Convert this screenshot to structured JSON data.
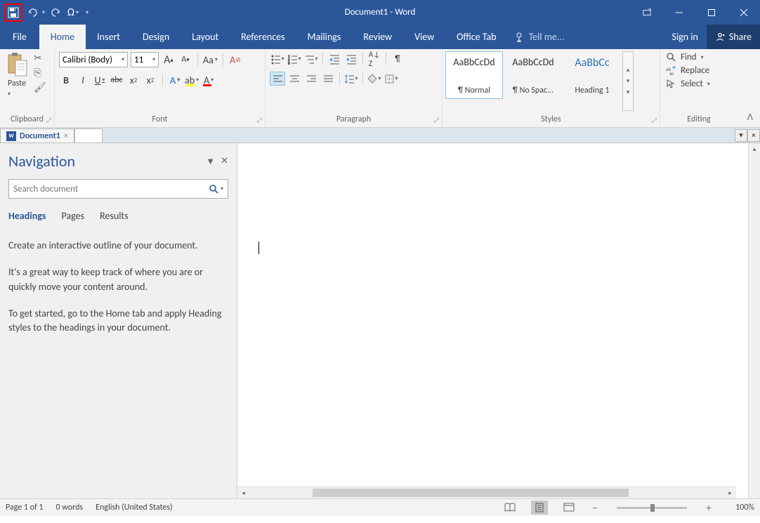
{
  "title": "Document1 - Word",
  "qat": {
    "omega": "Ω"
  },
  "tabs": {
    "file": "File",
    "home": "Home",
    "insert": "Insert",
    "design": "Design",
    "layout": "Layout",
    "references": "References",
    "mailings": "Mailings",
    "review": "Review",
    "view": "View",
    "office_tab": "Office Tab"
  },
  "tell_me": "Tell me...",
  "signin": "Sign in",
  "share": "Share",
  "ribbon": {
    "clipboard": {
      "paste": "Paste",
      "label": "Clipboard"
    },
    "font": {
      "name": "Calibri (Body)",
      "size": "11",
      "label": "Font",
      "grow": "A",
      "shrink": "A",
      "case": "Aa",
      "clear": "A",
      "bold": "B",
      "italic": "I",
      "underline": "U",
      "strike": "abc",
      "sub": "x",
      "sup": "x",
      "effects": "A",
      "highlight": "ab",
      "color": "A"
    },
    "paragraph": {
      "label": "Paragraph",
      "pilcrow": "¶"
    },
    "styles": {
      "label": "Styles",
      "items": [
        {
          "sample": "AaBbCcDd",
          "name": "¶ Normal"
        },
        {
          "sample": "AaBbCcDd",
          "name": "¶ No Spac..."
        },
        {
          "sample": "AaBbCc",
          "name": "Heading 1"
        }
      ]
    },
    "editing": {
      "find": "Find",
      "replace": "Replace",
      "select": "Select",
      "label": "Editing"
    }
  },
  "doctab": {
    "name": "Document1"
  },
  "navigation": {
    "title": "Navigation",
    "search_placeholder": "Search document",
    "tabs": {
      "headings": "Headings",
      "pages": "Pages",
      "results": "Results"
    },
    "p1": "Create an interactive outline of your document.",
    "p2": "It's a great way to keep track of where you are or quickly move your content around.",
    "p3": "To get started, go to the Home tab and apply Heading styles to the headings in your document."
  },
  "status": {
    "page": "Page 1 of 1",
    "words": "0 words",
    "lang": "English (United States)",
    "zoom": "100%"
  }
}
